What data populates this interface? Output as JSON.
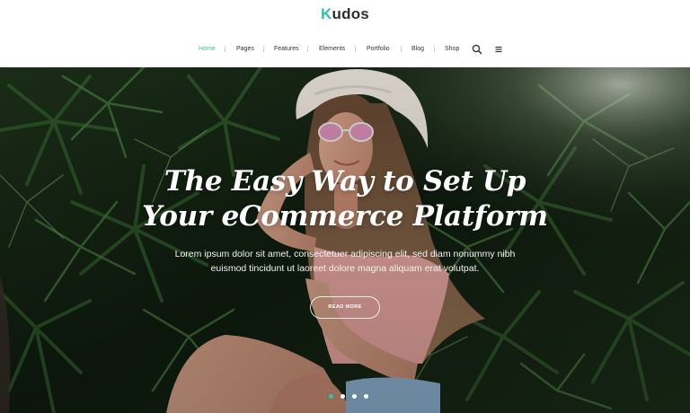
{
  "brand": {
    "name": "udos",
    "initial": "K",
    "accent": "#35bfa8"
  },
  "nav": {
    "items": [
      {
        "label": "Home",
        "active": true
      },
      {
        "label": "Pages"
      },
      {
        "label": "Features"
      },
      {
        "label": "Elements"
      },
      {
        "label": "Portfolio"
      },
      {
        "label": "Blog"
      },
      {
        "label": "Shop"
      }
    ],
    "icons": [
      "search-icon",
      "menu-icon"
    ]
  },
  "hero": {
    "title_line1": "The Easy Way to Set Up",
    "title_line2": "Your eCommerce Platform",
    "subtitle_line1": "Lorem ipsum dolor sit amet, consectetuer adipiscing elit, sed diam nonummy nibh",
    "subtitle_line2": "euismod tincidunt ut laoreet dolore magna aliquam erat volutpat.",
    "cta_label": "READ MORE",
    "slides": {
      "count": 4,
      "active": 1
    }
  }
}
